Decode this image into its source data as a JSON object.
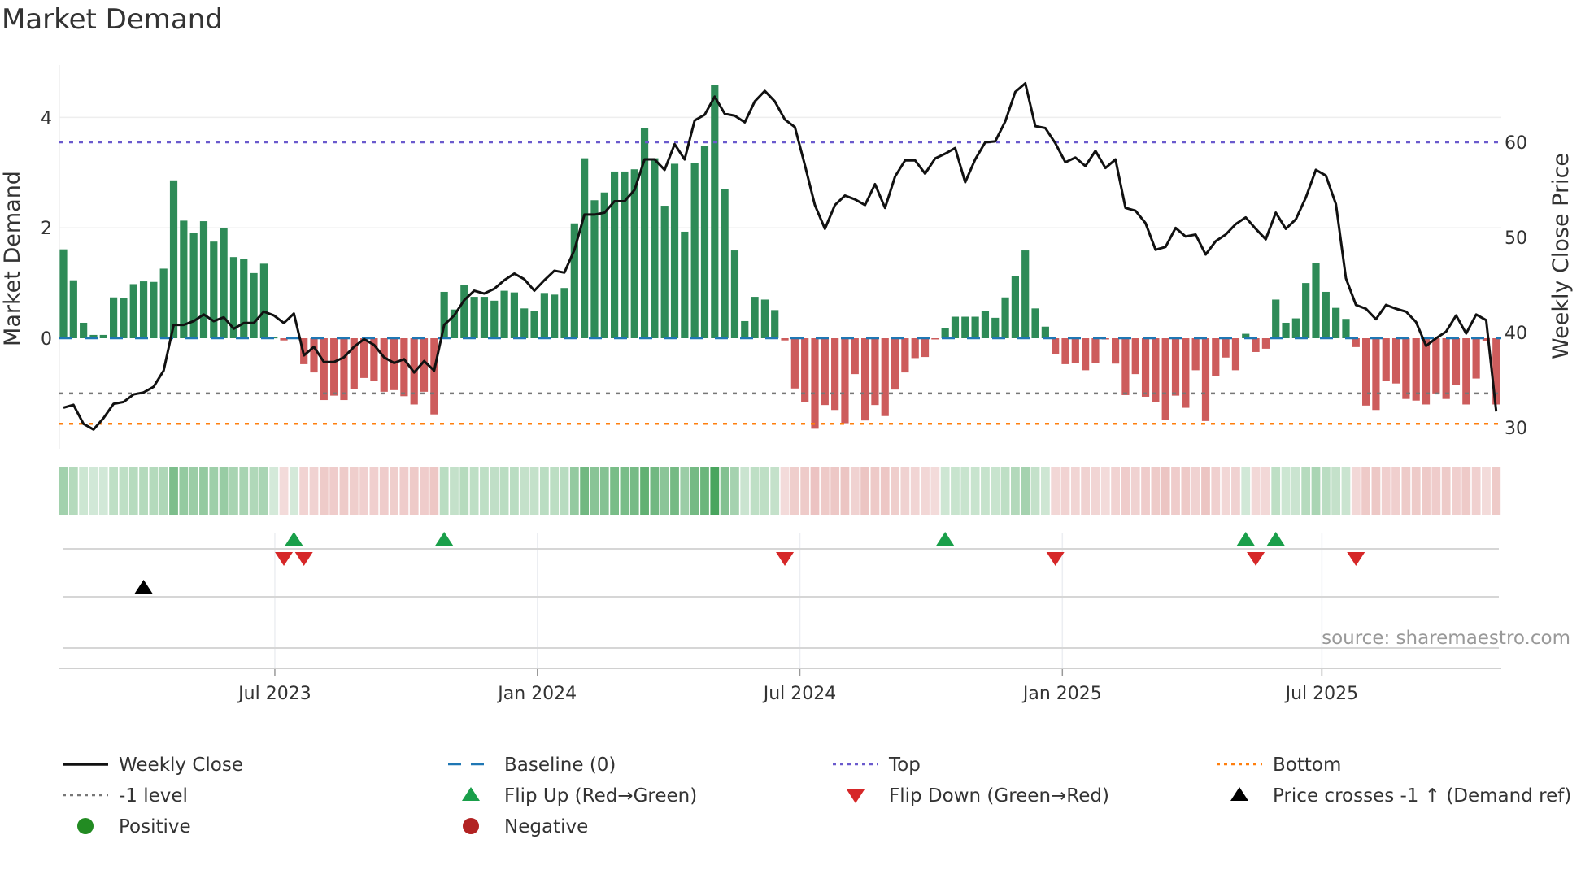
{
  "title": "Market Demand",
  "source": "source: sharemaestro.com",
  "chart_data": {
    "type": "bar",
    "title": "Market Demand",
    "ylabel": "Market Demand",
    "y2label": "Weekly Close Price",
    "ylim": [
      -1.7,
      4.9
    ],
    "y2lim": [
      28.5,
      68.5
    ],
    "yticks": [
      "4",
      "2",
      "0"
    ],
    "yticks_values": [
      4,
      2,
      0
    ],
    "y2ticks": [
      "60",
      "50",
      "40",
      "30"
    ],
    "y2ticks_values": [
      60,
      50,
      40,
      30
    ],
    "xticks": [
      {
        "label": "Jul 2023",
        "week": 21.1
      },
      {
        "label": "Jan 2024",
        "week": 47.3
      },
      {
        "label": "Jul 2024",
        "week": 73.5
      },
      {
        "label": "Jan 2025",
        "week": 99.7
      },
      {
        "label": "Jul 2025",
        "week": 125.6
      }
    ],
    "levels": {
      "top": 3.55,
      "bottom": -1.55,
      "minus_one": -1,
      "baseline": 0
    },
    "demand": [
      1.61,
      1.05,
      0.28,
      0.06,
      0.06,
      0.74,
      0.73,
      0.98,
      1.03,
      1.02,
      1.26,
      2.86,
      2.13,
      1.9,
      2.12,
      1.75,
      1.99,
      1.47,
      1.43,
      1.18,
      1.35,
      0.02,
      -0.04,
      0.02,
      -0.47,
      -0.62,
      -1.12,
      -1.04,
      -1.12,
      -0.92,
      -0.72,
      -0.78,
      -0.97,
      -0.94,
      -1.05,
      -1.2,
      -0.97,
      -1.38,
      0.84,
      0.52,
      0.96,
      0.75,
      0.75,
      0.68,
      0.86,
      0.83,
      0.54,
      0.5,
      0.82,
      0.79,
      0.91,
      2.08,
      3.26,
      2.5,
      2.64,
      3.02,
      3.02,
      3.06,
      3.81,
      3.26,
      2.4,
      3.16,
      1.93,
      3.18,
      3.48,
      4.59,
      2.7,
      1.59,
      0.31,
      0.75,
      0.7,
      0.51,
      -0.04,
      -0.91,
      -1.16,
      -1.64,
      -1.21,
      -1.3,
      -1.54,
      -0.65,
      -1.49,
      -1.21,
      -1.41,
      -0.93,
      -0.62,
      -0.36,
      -0.34,
      -0.02,
      0.18,
      0.39,
      0.39,
      0.39,
      0.49,
      0.37,
      0.74,
      1.13,
      1.59,
      0.54,
      0.21,
      -0.28,
      -0.47,
      -0.45,
      -0.58,
      -0.45,
      -0.01,
      -0.46,
      -1.03,
      -0.65,
      -1.06,
      -1.16,
      -1.48,
      -1.04,
      -1.26,
      -0.58,
      -1.5,
      -0.68,
      -0.35,
      -0.58,
      0.08,
      -0.25,
      -0.19,
      0.7,
      0.28,
      0.36,
      1.0,
      1.36,
      0.84,
      0.55,
      0.35,
      -0.16,
      -1.22,
      -1.3,
      -0.77,
      -0.82,
      -1.1,
      -1.13,
      -1.2,
      -1.0,
      -1.1,
      -0.85,
      -1.2,
      -0.73,
      -0.05,
      -1.2
    ],
    "weekly_close": [
      32.1,
      32.4,
      30.4,
      29.8,
      31.0,
      32.5,
      32.7,
      33.5,
      33.7,
      34.3,
      36.0,
      40.8,
      40.8,
      41.2,
      41.9,
      41.2,
      41.6,
      40.4,
      41.0,
      41.0,
      42.2,
      41.8,
      41.0,
      42.0,
      37.6,
      38.5,
      36.9,
      36.9,
      37.4,
      38.5,
      39.3,
      38.7,
      37.4,
      36.8,
      37.2,
      35.8,
      37.0,
      36.0,
      40.8,
      41.8,
      43.4,
      44.4,
      44.1,
      44.6,
      45.5,
      46.2,
      45.6,
      44.4,
      45.5,
      46.5,
      46.3,
      48.7,
      52.4,
      52.4,
      52.6,
      53.8,
      53.8,
      55.0,
      58.2,
      58.2,
      57.1,
      59.8,
      58.2,
      62.3,
      62.9,
      64.8,
      63.0,
      62.8,
      62.1,
      64.3,
      65.4,
      64.3,
      62.4,
      61.6,
      57.6,
      53.4,
      50.9,
      53.4,
      54.4,
      54.0,
      53.4,
      55.6,
      53.1,
      56.4,
      58.1,
      58.1,
      56.7,
      58.3,
      58.8,
      59.4,
      55.8,
      58.2,
      60.0,
      60.1,
      62.2,
      65.3,
      66.2,
      61.7,
      61.5,
      59.9,
      57.9,
      58.4,
      57.5,
      59.1,
      57.3,
      58.2,
      53.1,
      52.8,
      51.5,
      48.7,
      49.0,
      51.0,
      50.1,
      50.3,
      48.2,
      49.6,
      50.3,
      51.4,
      52.1,
      50.9,
      49.8,
      52.6,
      50.9,
      51.9,
      54.2,
      57.1,
      56.5,
      53.5,
      45.7,
      42.9,
      42.5,
      41.4,
      42.9,
      42.5,
      42.2,
      41.1,
      38.6,
      39.4,
      40.1,
      41.8,
      39.9,
      41.9,
      41.3,
      31.7
    ],
    "flip_up_weeks": [
      23,
      38,
      88,
      118,
      121
    ],
    "flip_down_weeks": [
      22,
      24,
      72,
      99,
      119,
      129
    ],
    "price_cross_weeks": [
      8
    ],
    "legend": [
      {
        "label": "Weekly Close",
        "kind": "line-solid",
        "color": "#111111"
      },
      {
        "label": "Baseline (0)",
        "kind": "line-dashed",
        "color": "#1f77b4"
      },
      {
        "label": "Top",
        "kind": "line-dotted",
        "color": "#6a5acd"
      },
      {
        "label": "Bottom",
        "kind": "line-dotted",
        "color": "#ff7f0e"
      },
      {
        "label": "-1 level",
        "kind": "line-dotted",
        "color": "#777777"
      },
      {
        "label": "Flip Up (Red→Green)",
        "kind": "tri-up",
        "color": "#1a9f4a"
      },
      {
        "label": "Flip Down (Green→Red)",
        "kind": "tri-down",
        "color": "#d62728"
      },
      {
        "label": "Price crosses -1 ↑ (Demand ref)",
        "kind": "tri-up",
        "color": "#000000"
      },
      {
        "label": "Positive",
        "kind": "dot",
        "color": "#228b22"
      },
      {
        "label": "Negative",
        "kind": "dot",
        "color": "#b22222"
      }
    ],
    "legend_placement": "bottom",
    "colors": {
      "positive_bar": "#2e8b57",
      "negative_bar": "#cd5c5c",
      "heat_pos": "#3a9d50",
      "heat_neg": "#d06e6a",
      "grid": "#eeeeee"
    }
  }
}
